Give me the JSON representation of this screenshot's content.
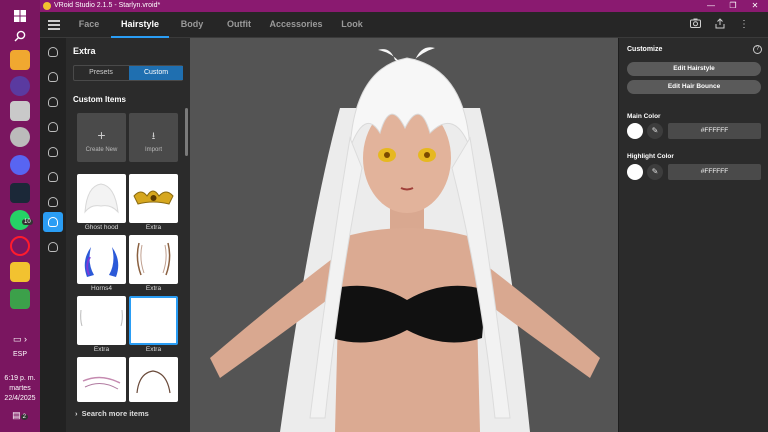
{
  "window": {
    "title": "VRoid Studio 2.1.5 - Starlyn.vroid*"
  },
  "taskbar": {
    "lang": "ESP",
    "time": "6:19 p. m.",
    "day": "martes",
    "date": "22/4/2025",
    "whatsapp_badge": "10",
    "notification_badge": "2"
  },
  "menu": {
    "tabs": [
      {
        "label": "Face"
      },
      {
        "label": "Hairstyle"
      },
      {
        "label": "Body"
      },
      {
        "label": "Outfit"
      },
      {
        "label": "Accessories"
      },
      {
        "label": "Look"
      }
    ],
    "active_tab": "Hairstyle"
  },
  "left_panel": {
    "title": "Extra",
    "segments": {
      "presets": "Presets",
      "custom": "Custom"
    },
    "section_title": "Custom Items",
    "create_new": "Create New",
    "import": "Import",
    "items": [
      {
        "label": "Ghost hood"
      },
      {
        "label": "Extra"
      },
      {
        "label": "Horns4"
      },
      {
        "label": "Extra"
      },
      {
        "label": "Extra"
      },
      {
        "label": "Extra"
      }
    ],
    "search_more": "Search more items"
  },
  "right_panel": {
    "title": "Customize",
    "edit_hairstyle": "Edit Hairstyle",
    "edit_hair_bounce": "Edit Hair Bounce",
    "main_color_label": "Main Color",
    "main_color_hex": "#FFFFFF",
    "highlight_color_label": "Highlight Color",
    "highlight_color_hex": "#FFFFFF"
  },
  "colors": {
    "accent": "#2a9df4",
    "taskbar": "#7a1660",
    "titlebar": "#8a1a70"
  }
}
